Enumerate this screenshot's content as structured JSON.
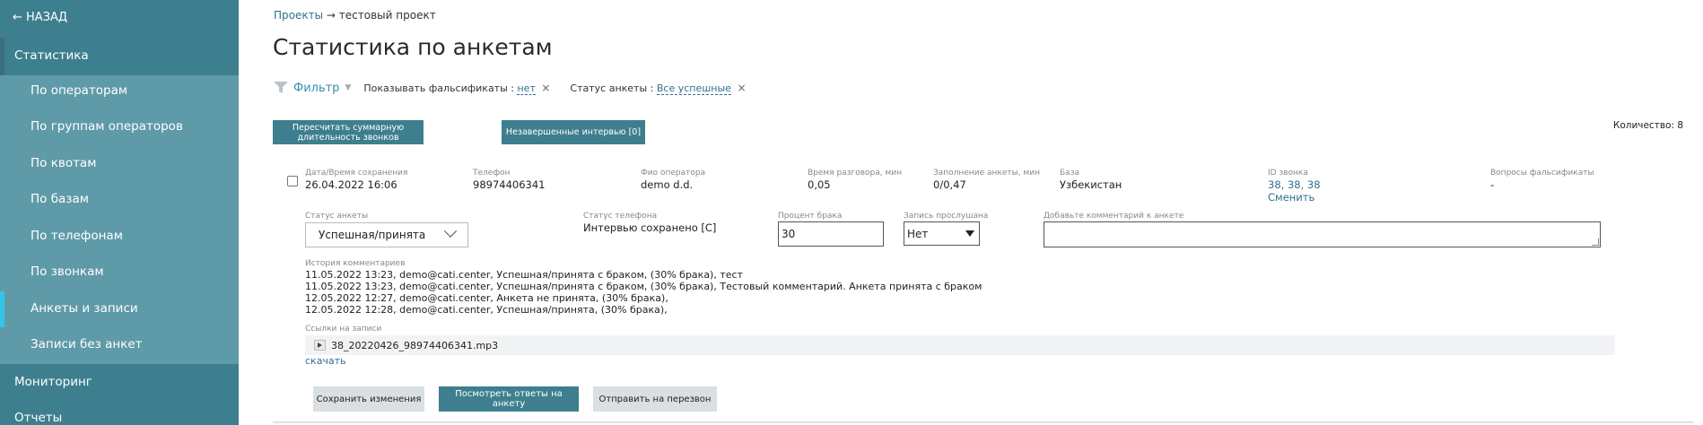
{
  "sidebar": {
    "back": "← НАЗАД",
    "section_stats": "Статистика",
    "items": [
      {
        "label": "По операторам"
      },
      {
        "label": "По группам операторов"
      },
      {
        "label": "По квотам"
      },
      {
        "label": "По базам"
      },
      {
        "label": "По телефонам"
      },
      {
        "label": "По звонкам"
      },
      {
        "label": "Анкеты и записи",
        "active": true
      },
      {
        "label": "Записи без анкет"
      }
    ],
    "section_monitoring": "Мониторинг",
    "section_reports": "Отчеты"
  },
  "breadcrumb": {
    "projects": "Проекты",
    "separator": "→",
    "current": "тестовый проект"
  },
  "page_title": "Статистика по анкетам",
  "filter": {
    "label": "Фильтр",
    "chips": [
      {
        "key": "Показывать фальсификаты :",
        "value": "нет"
      },
      {
        "key": "Статус анкеты :",
        "value": "Все успешные"
      }
    ]
  },
  "buttons": {
    "recalc": "Пересчитать суммарную длительность звонков",
    "incomplete": "Незавершенные интервью [0]",
    "save": "Сохранить изменения",
    "view_answers": "Посмотреть ответы на анкету",
    "send_recall": "Отправить на перезвон"
  },
  "count_label": "Количество: 8",
  "record": {
    "saved_label": "Дата/Время сохранения",
    "saved_value": "26.04.2022 16:06",
    "phone_label": "Телефон",
    "phone_value": "98974406341",
    "operator_label": "Фио оператора",
    "operator_value": "demo d.d.",
    "talk_label": "Время разговора, мин",
    "talk_value": "0,05",
    "fill_label": "Заполнение анкеты, мин",
    "fill_value": "0/0,47",
    "base_label": "База",
    "base_value": "Узбекистан",
    "call_id_label": "ID звонка",
    "call_id_value": "38, 38, 38",
    "call_id_change": "Сменить",
    "falsif_label": "Вопросы фальсификаты",
    "falsif_value": "-",
    "status_label": "Статус анкеты",
    "status_value": "Успешная/принята",
    "phone_status_label": "Статус телефона",
    "phone_status_value": "Интервью сохранено [C]",
    "defect_label": "Процент брака",
    "defect_value": "30",
    "listened_label": "Запись прослушана",
    "listened_value": "Нет",
    "comment_label": "Добавьте комментарий к анкете",
    "history_label": "История комментариев",
    "history": [
      "11.05.2022 13:23, demo@cati.center, Успешная/принята с браком, (30% брака), тест",
      "11.05.2022 13:23, demo@cati.center, Успешная/принята с браком, (30% брака), Тестовый комментарий. Анкета принята с браком",
      "12.05.2022 12:27, demo@cati.center, Анкета не принята, (30% брака),",
      "12.05.2022 12:28, demo@cati.center, Успешная/принята, (30% брака),"
    ],
    "links_label": "Ссылки на записи",
    "audio_file": "38_20220426_98974406341.mp3",
    "download": "скачать"
  },
  "colors": {
    "accent": "#3d7f8e",
    "sidebar": "#5f9aa8",
    "active_marker": "#35c4e8",
    "link": "#2e7290"
  }
}
